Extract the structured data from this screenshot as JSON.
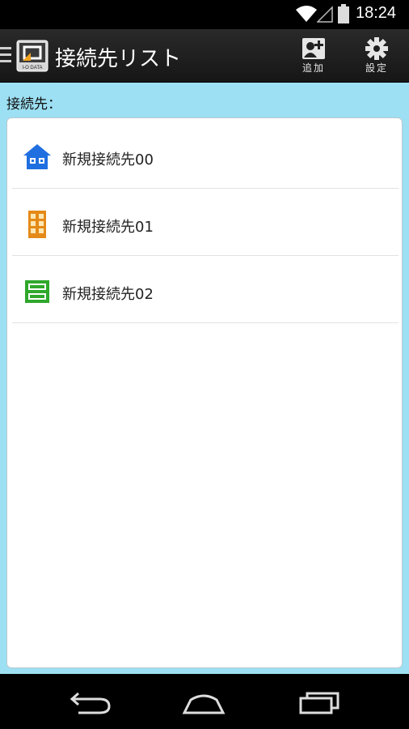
{
  "status_bar": {
    "time": "18:24"
  },
  "action_bar": {
    "title": "接続先リスト",
    "logo_text": "I-O DATA",
    "add_label": "追加",
    "settings_label": "設定"
  },
  "section_label": "接続先：",
  "connections": [
    {
      "name": "新規接続先00",
      "icon": "house-icon",
      "color": "#1f6fe0"
    },
    {
      "name": "新規接続先01",
      "icon": "building-icon",
      "color": "#e58a18"
    },
    {
      "name": "新規接続先02",
      "icon": "server-icon",
      "color": "#2fa82c"
    }
  ]
}
